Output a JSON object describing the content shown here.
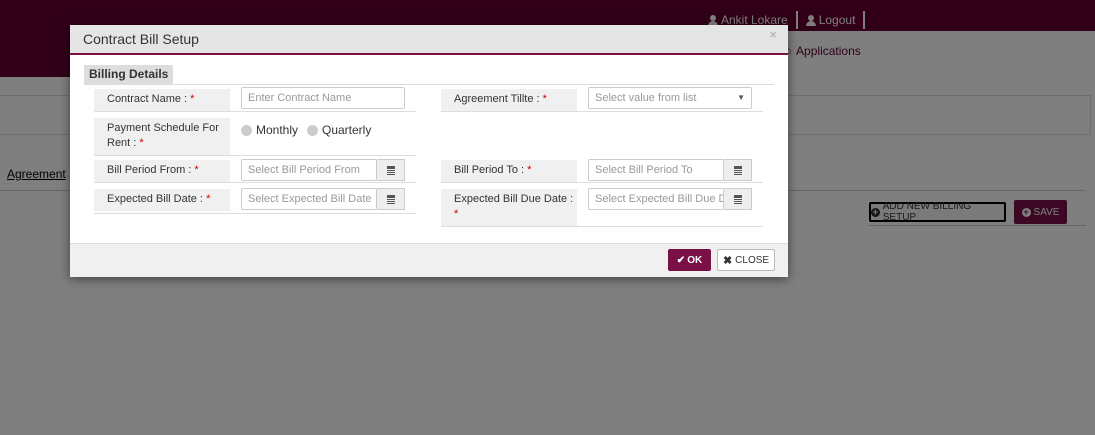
{
  "header": {
    "user_name": "Ankit Lokare",
    "logout_label": "Logout",
    "applications_label": "Applications"
  },
  "page": {
    "agreement_tab": "Agreement",
    "add_billing_label": "ADD NEW BILLING SETUP",
    "save_label": "SAVE"
  },
  "modal": {
    "title": "Contract Bill Setup",
    "close_glyph": "×",
    "section_label": "Billing Details",
    "required_mark": "*",
    "fields": {
      "contract_name": {
        "label": "Contract Name :",
        "placeholder": "Enter Contract Name"
      },
      "agreement_title": {
        "label": "Agreement Tillte :",
        "placeholder": "Select value from list"
      },
      "payment_schedule": {
        "label": "Payment Schedule For Rent :",
        "options": [
          "Monthly",
          "Quarterly"
        ]
      },
      "bill_period_from": {
        "label": "Bill Period From :",
        "placeholder": "Select Bill Period From"
      },
      "bill_period_to": {
        "label": "Bill Period To :",
        "placeholder": "Select Bill Period To"
      },
      "expected_bill_date": {
        "label": "Expected Bill Date :",
        "placeholder": "Select Expected Bill Date"
      },
      "expected_bill_due_date": {
        "label": "Expected Bill Due Date :",
        "placeholder": "Select Expected Bill Due D"
      }
    },
    "ok_label": "OK",
    "close_label": "CLOSE"
  },
  "colors": {
    "brand": "#630030",
    "button": "#7a1046",
    "required": "#cc0000"
  }
}
